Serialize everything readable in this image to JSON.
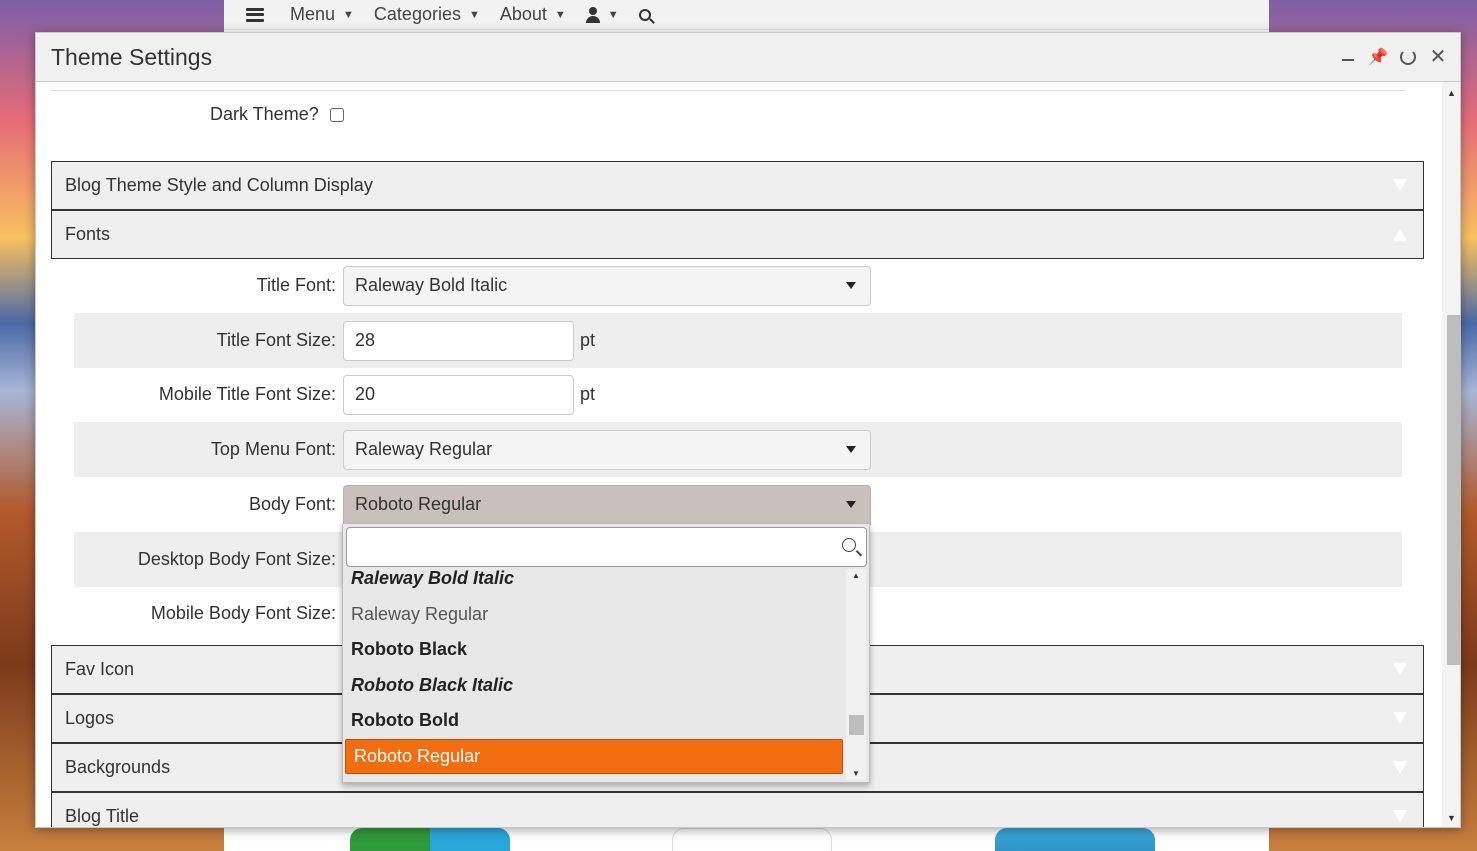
{
  "topnav": {
    "menu_label": "Menu",
    "categories_label": "Categories",
    "about_label": "About"
  },
  "dialog": {
    "title": "Theme Settings",
    "dark_theme_label": "Dark Theme?",
    "dark_theme_checked": false
  },
  "sections": {
    "blog_theme": "Blog Theme Style and Column Display",
    "fonts": "Fonts",
    "fav_icon": "Fav Icon",
    "logos": "Logos",
    "backgrounds": "Backgrounds",
    "blog_title": "Blog Title"
  },
  "fonts_form": {
    "title_font_label": "Title Font:",
    "title_font_value": "Raleway Bold Italic",
    "title_font_size_label": "Title Font Size:",
    "title_font_size_value": "28",
    "mobile_title_font_size_label": "Mobile Title Font Size:",
    "mobile_title_font_size_value": "20",
    "top_menu_font_label": "Top Menu Font:",
    "top_menu_font_value": "Raleway Regular",
    "body_font_label": "Body Font:",
    "body_font_value": "Roboto Regular",
    "desktop_body_font_size_label": "Desktop Body Font Size:",
    "mobile_body_font_size_label": "Mobile Body Font Size:",
    "unit": "pt"
  },
  "dropdown": {
    "search_value": "",
    "options": [
      "Raleway Bold Italic",
      "Raleway Regular",
      "Roboto Black",
      "Roboto Black Italic",
      "Roboto Bold",
      "Roboto Regular"
    ],
    "selected": "Roboto Regular"
  },
  "colors": {
    "accent": "#f26d10",
    "header_bg": "#f0f0f0",
    "open_select_bg": "#c9c0bc"
  }
}
